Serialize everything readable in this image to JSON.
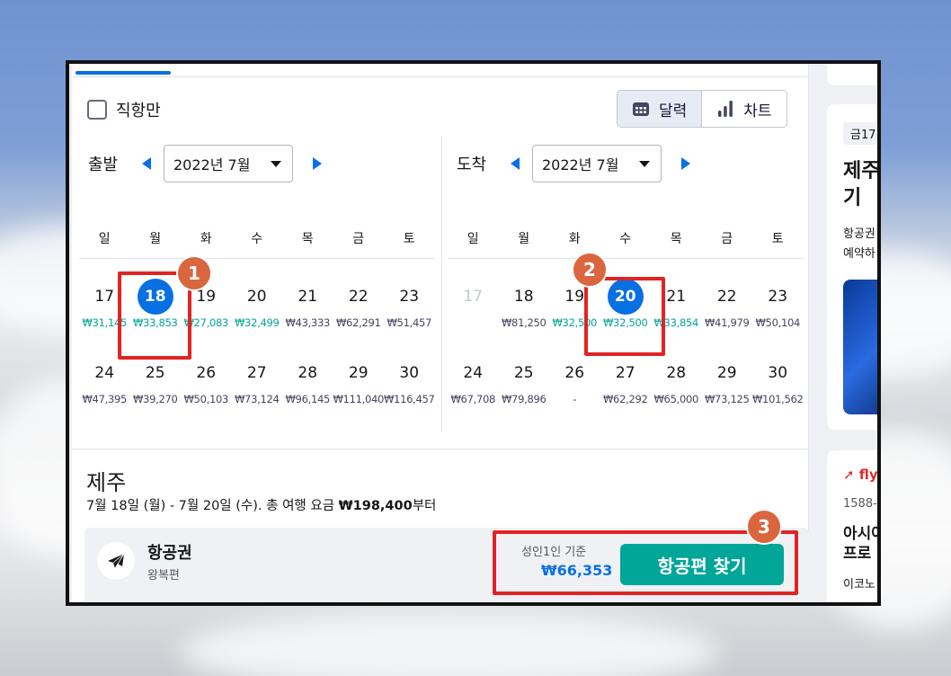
{
  "filters": {
    "direct_only_label": "직항만"
  },
  "view_toggle": {
    "calendar_label": "달력",
    "chart_label": "차트"
  },
  "departure": {
    "title": "출발",
    "month": "2022년 7월",
    "weekdays": [
      "일",
      "월",
      "화",
      "수",
      "목",
      "금",
      "토"
    ],
    "weeks": [
      [
        {
          "day": "17",
          "price": "₩31,145",
          "green": true
        },
        {
          "day": "18",
          "price": "₩33,853",
          "green": true,
          "selected": true
        },
        {
          "day": "19",
          "price": "₩27,083",
          "green": true
        },
        {
          "day": "20",
          "price": "₩32,499",
          "green": true
        },
        {
          "day": "21",
          "price": "₩43,333",
          "green": false
        },
        {
          "day": "22",
          "price": "₩62,291",
          "green": false
        },
        {
          "day": "23",
          "price": "₩51,457",
          "green": false
        }
      ],
      [
        {
          "day": "24",
          "price": "₩47,395",
          "green": false
        },
        {
          "day": "25",
          "price": "₩39,270",
          "green": false
        },
        {
          "day": "26",
          "price": "₩50,103",
          "green": false
        },
        {
          "day": "27",
          "price": "₩73,124",
          "green": false
        },
        {
          "day": "28",
          "price": "₩96,145",
          "green": false
        },
        {
          "day": "29",
          "price": "₩111,040",
          "green": false
        },
        {
          "day": "30",
          "price": "₩116,457",
          "green": false
        }
      ]
    ]
  },
  "arrival": {
    "title": "도착",
    "month": "2022년 7월",
    "weekdays": [
      "일",
      "월",
      "화",
      "수",
      "목",
      "금",
      "토"
    ],
    "weeks": [
      [
        {
          "day": "17",
          "price": "",
          "green": false,
          "muted": true
        },
        {
          "day": "18",
          "price": "₩81,250",
          "green": false
        },
        {
          "day": "19",
          "price": "₩32,500",
          "green": true
        },
        {
          "day": "20",
          "price": "₩32,500",
          "green": true,
          "selected": true
        },
        {
          "day": "21",
          "price": "₩33,854",
          "green": true
        },
        {
          "day": "22",
          "price": "₩41,979",
          "green": false
        },
        {
          "day": "23",
          "price": "₩50,104",
          "green": false
        }
      ],
      [
        {
          "day": "24",
          "price": "₩67,708",
          "green": false
        },
        {
          "day": "25",
          "price": "₩79,896",
          "green": false
        },
        {
          "day": "26",
          "price": "-",
          "green": false
        },
        {
          "day": "27",
          "price": "₩62,292",
          "green": false
        },
        {
          "day": "28",
          "price": "₩65,000",
          "green": false
        },
        {
          "day": "29",
          "price": "₩73,125",
          "green": false
        },
        {
          "day": "30",
          "price": "₩101,562",
          "green": false
        }
      ]
    ]
  },
  "trip": {
    "destination": "제주",
    "dates": "7월 18일 (월) - 7월 20일 (수).  총 여행 요금 ",
    "total": "₩198,400",
    "total_suffix": "부터"
  },
  "flight": {
    "title": "항공권",
    "subtitle": "왕복편",
    "price_label": "성인1인 기준",
    "price": "₩66,353",
    "button_label": "항공편 찾기"
  },
  "side_ad": {
    "badge": "금17",
    "title_line1": "제주",
    "title_line2": "기",
    "text_line1": "항공권",
    "text_line2": "예약하"
  },
  "side_ad2": {
    "logo": "fly",
    "phone": "1588-",
    "title_line1": "아시아",
    "title_line2": "프로",
    "text": "이코노"
  },
  "annotations": [
    "1",
    "2",
    "3"
  ],
  "colors": {
    "accent": "#0770e3",
    "green": "#00a698",
    "highlight": "#e02424",
    "badge": "#d9663f"
  }
}
